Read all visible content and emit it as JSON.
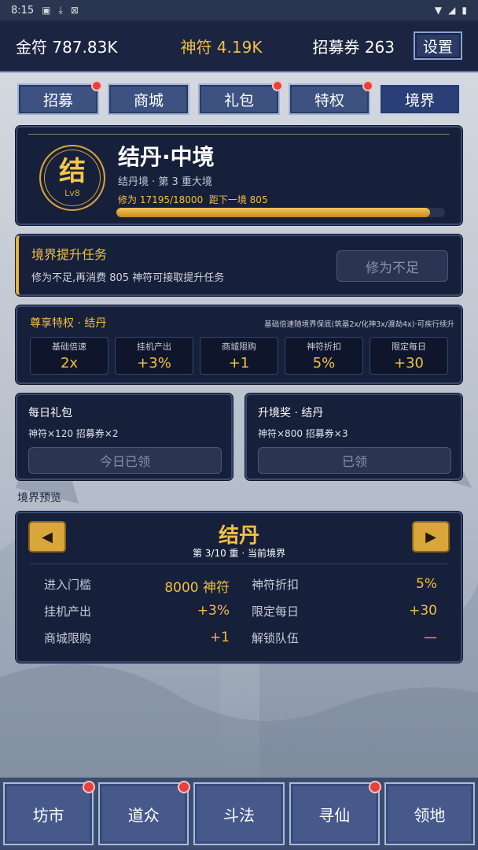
{
  "status": {
    "time": "8:15"
  },
  "topbar": {
    "gold": "金符 787.83K",
    "spirit": "神符 4.19K",
    "ticket": "招募券 263",
    "settings": "设置"
  },
  "tabs": [
    {
      "label": "招募",
      "badge": true
    },
    {
      "label": "商城",
      "badge": false
    },
    {
      "label": "礼包",
      "badge": true
    },
    {
      "label": "特权",
      "badge": true
    },
    {
      "label": "境界",
      "badge": false,
      "active": true
    }
  ],
  "realm": {
    "emblem_char": "结",
    "emblem_level": "Lv8",
    "name": "结丹·中境",
    "sub": "结丹境 · 第 3 重大境",
    "progress_label": "修为 17195/18000",
    "progress_next": "距下一境 805",
    "progress_fraction": 0.955
  },
  "task": {
    "title": "境界提升任务",
    "desc": "修为不足,再消费 805 神符可接取提升任务",
    "button": "修为不足"
  },
  "privilege": {
    "title": "尊享特权 · 结丹",
    "note": "基础倍速随境界保底(筑基2x/化神3x/渡劫4x)·可疾行续升",
    "cells": [
      {
        "k": "基础倍速",
        "v": "2x"
      },
      {
        "k": "挂机产出",
        "v": "+3%"
      },
      {
        "k": "商城限购",
        "v": "+1"
      },
      {
        "k": "神符折扣",
        "v": "5%"
      },
      {
        "k": "限定每日",
        "v": "+30"
      }
    ]
  },
  "daily": {
    "title": "每日礼包",
    "reward": "神符×120  招募券×2",
    "button": "今日已领"
  },
  "upgrade": {
    "title": "升境奖 · 结丹",
    "reward": "神符×800  招募券×3",
    "button": "已领"
  },
  "preview": {
    "section_title": "境界预览",
    "name": "结丹",
    "sub": "第 3/10 重 · 当前境界",
    "left": [
      {
        "k": "进入门槛",
        "v": "8000 神符"
      },
      {
        "k": "挂机产出",
        "v": "+3%"
      },
      {
        "k": "商城限购",
        "v": "+1"
      }
    ],
    "right": [
      {
        "k": "神符折扣",
        "v": "5%"
      },
      {
        "k": "限定每日",
        "v": "+30"
      },
      {
        "k": "解锁队伍",
        "v": "—"
      }
    ]
  },
  "bottom_nav": [
    {
      "label": "坊市",
      "badge": true
    },
    {
      "label": "道众",
      "badge": true
    },
    {
      "label": "斗法",
      "badge": false
    },
    {
      "label": "寻仙",
      "badge": true
    },
    {
      "label": "领地",
      "badge": false
    }
  ],
  "colors": {
    "accent": "#f0c040",
    "panel": "#17203a",
    "badge": "#e8413d"
  }
}
